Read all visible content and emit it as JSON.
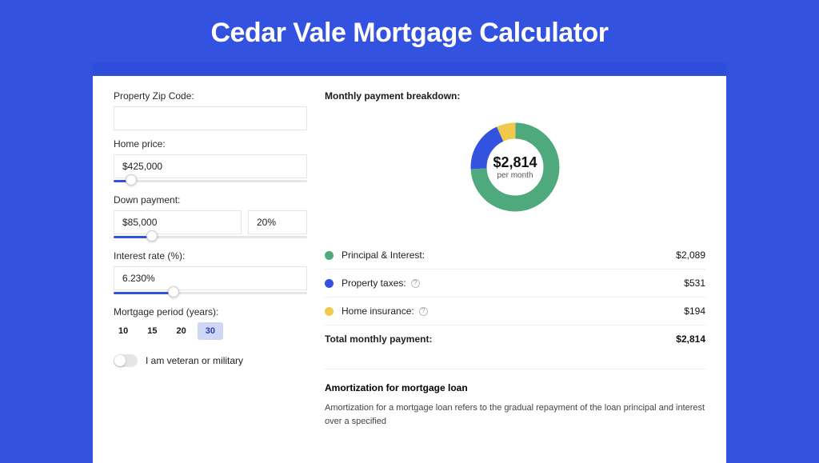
{
  "page": {
    "title": "Cedar Vale Mortgage Calculator"
  },
  "form": {
    "zip": {
      "label": "Property Zip Code:",
      "value": ""
    },
    "price": {
      "label": "Home price:",
      "value": "$425,000",
      "slider_pct": 9
    },
    "down": {
      "label": "Down payment:",
      "amount": "$85,000",
      "percent": "20%",
      "slider_pct": 20
    },
    "rate": {
      "label": "Interest rate (%):",
      "value": "6.230%",
      "slider_pct": 31
    },
    "period": {
      "label": "Mortgage period (years):",
      "options": [
        "10",
        "15",
        "20",
        "30"
      ],
      "selected": "30"
    },
    "veteran": {
      "label": "I am veteran or military",
      "on": false
    }
  },
  "breakdown": {
    "title": "Monthly payment breakdown:",
    "center_amount": "$2,814",
    "center_sub": "per month",
    "items": [
      {
        "label": "Principal & Interest:",
        "value": "$2,089",
        "color": "g",
        "info": false
      },
      {
        "label": "Property taxes:",
        "value": "$531",
        "color": "b",
        "info": true
      },
      {
        "label": "Home insurance:",
        "value": "$194",
        "color": "y",
        "info": true
      }
    ],
    "total_label": "Total monthly payment:",
    "total_value": "$2,814"
  },
  "amort": {
    "title": "Amortization for mortgage loan",
    "body": "Amortization for a mortgage loan refers to the gradual repayment of the loan principal and interest over a specified"
  },
  "chart_data": {
    "type": "pie",
    "title": "Monthly payment breakdown",
    "series": [
      {
        "name": "Principal & Interest",
        "value": 2089,
        "color": "#4EA97D"
      },
      {
        "name": "Property taxes",
        "value": 531,
        "color": "#3452E0"
      },
      {
        "name": "Home insurance",
        "value": 194,
        "color": "#F0C94B"
      }
    ],
    "total": 2814,
    "center_label": "$2,814 per month"
  }
}
